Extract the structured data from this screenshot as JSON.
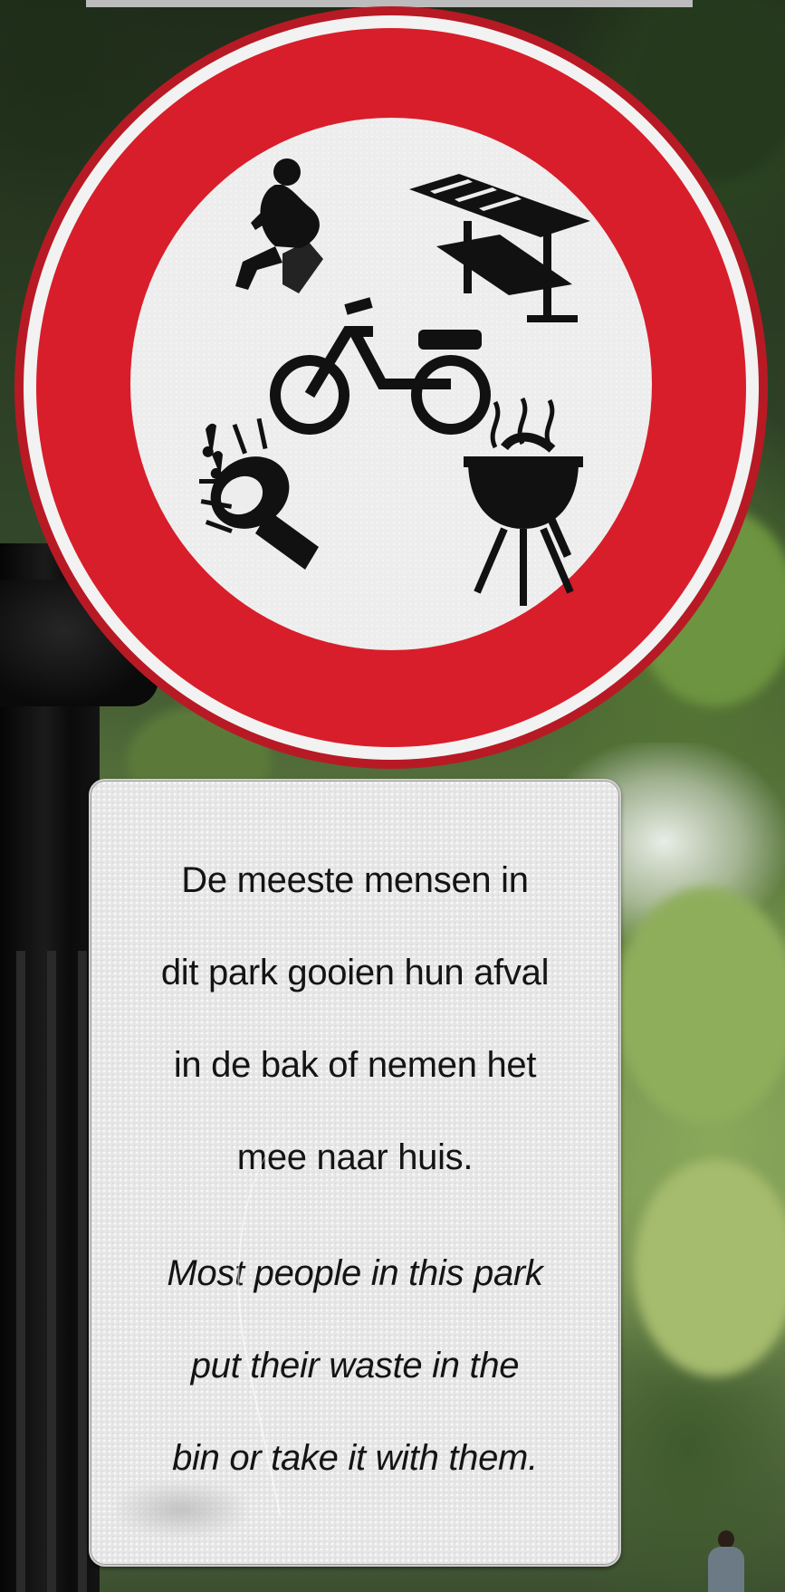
{
  "scene": {
    "description_free": true
  },
  "round_sign": {
    "ring_color": "#d81e2a",
    "icons": [
      "person-sitting-icon",
      "picnic-shelter-icon",
      "moped-icon",
      "loudspeaker-music-icon",
      "barbecue-grill-icon"
    ]
  },
  "plate": {
    "dutch_lines": [
      "De meeste mensen in",
      "dit park gooien hun afval",
      "in de bak of nemen het",
      "mee naar huis."
    ],
    "english_lines": [
      "Most people in this park",
      "put their waste in the",
      "bin or take it with them."
    ]
  }
}
